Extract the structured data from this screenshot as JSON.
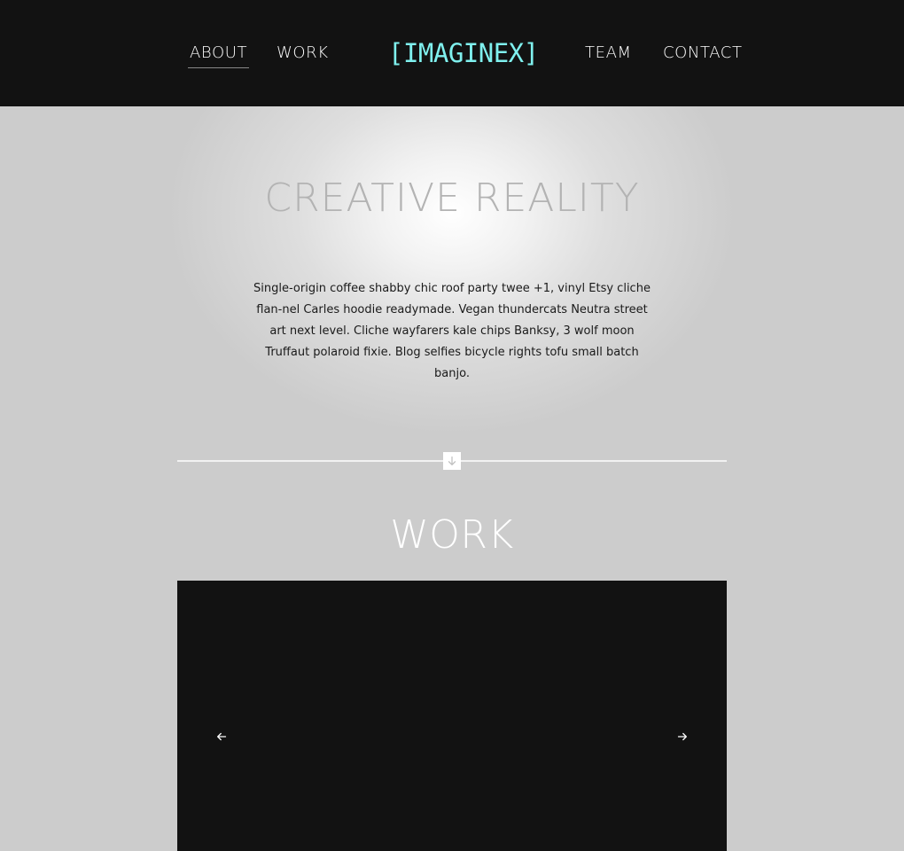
{
  "nav": {
    "left": [
      {
        "label": "ABOUT",
        "active": true
      },
      {
        "label": "WORK"
      }
    ],
    "logo": "[IMAGINEX]",
    "right": [
      {
        "label": "TEAM"
      },
      {
        "label": "CONTACT"
      }
    ]
  },
  "hero": {
    "title": "CREATIVE REALITY",
    "text": "Single-origin coffee shabby chic roof party twee +1, vinyl Etsy cliche flan-nel Carles hoodie readymade. Vegan thundercats Neutra street art next level. Cliche wayfarers kale chips Banksy, 3 wolf moon Truffaut polaroid fixie. Blog selfies bicycle rights tofu small batch banjo."
  },
  "work": {
    "title": "WORK"
  },
  "icons": {
    "scroll": "arrow-down-icon",
    "prev": "arrow-left-icon",
    "next": "arrow-right-icon"
  },
  "colors": {
    "header_bg": "#121212",
    "logo": "#7ff0ee",
    "page_bg": "#cccccc",
    "hero_title": "#b3b3b3",
    "slider_bg": "#121212"
  }
}
